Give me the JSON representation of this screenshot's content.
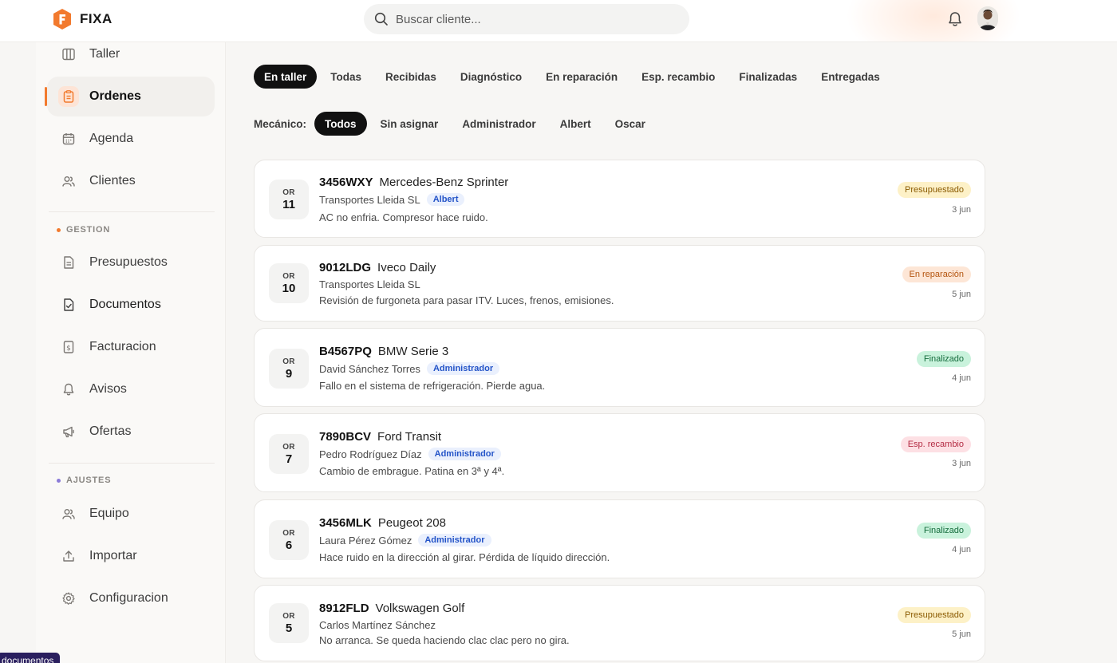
{
  "app": {
    "name": "FIXA",
    "brand_color": "#f27a2e"
  },
  "search": {
    "placeholder": "Buscar cliente..."
  },
  "sidebar": {
    "items": [
      {
        "label": "Taller",
        "icon": "columns-icon",
        "active": false
      },
      {
        "label": "Ordenes",
        "icon": "clipboard-icon",
        "active": true
      },
      {
        "label": "Agenda",
        "icon": "calendar-icon",
        "active": false
      },
      {
        "label": "Clientes",
        "icon": "users-icon",
        "active": false
      }
    ],
    "gestion": {
      "title": "GESTION",
      "items": [
        {
          "label": "Presupuestos",
          "icon": "file-text-icon"
        },
        {
          "label": "Documentos",
          "icon": "file-check-icon"
        },
        {
          "label": "Facturacion",
          "icon": "dollar-file-icon"
        },
        {
          "label": "Avisos",
          "icon": "bell-icon"
        },
        {
          "label": "Ofertas",
          "icon": "megaphone-icon"
        }
      ]
    },
    "ajustes": {
      "title": "AJUSTES",
      "items": [
        {
          "label": "Equipo",
          "icon": "users-icon"
        },
        {
          "label": "Importar",
          "icon": "upload-icon"
        },
        {
          "label": "Configuracion",
          "icon": "gear-icon"
        }
      ]
    }
  },
  "tooltip": {
    "text": "documentos"
  },
  "status_tabs": [
    "En taller",
    "Todas",
    "Recibidas",
    "Diagnóstico",
    "En reparación",
    "Esp. recambio",
    "Finalizadas",
    "Entregadas"
  ],
  "status_tab_active": "En taller",
  "mechanic_filter": {
    "label": "Mecánico:",
    "options": [
      "Todos",
      "Sin asignar",
      "Administrador",
      "Albert",
      "Oscar"
    ],
    "active": "Todos"
  },
  "orders": [
    {
      "or_label": "OR",
      "number": "11",
      "plate": "3456WXY",
      "model": "Mercedes-Benz Sprinter",
      "client": "Transportes Lleida SL",
      "mechanic": "Albert",
      "description": "AC no enfria. Compresor hace ruido.",
      "status": "Presupuestado",
      "date": "3 jun"
    },
    {
      "or_label": "OR",
      "number": "10",
      "plate": "9012LDG",
      "model": "Iveco Daily",
      "client": "Transportes Lleida SL",
      "mechanic": "",
      "description": "Revisión de furgoneta para pasar ITV. Luces, frenos, emisiones.",
      "status": "En reparación",
      "date": "5 jun"
    },
    {
      "or_label": "OR",
      "number": "9",
      "plate": "B4567PQ",
      "model": "BMW Serie 3",
      "client": "David Sánchez Torres",
      "mechanic": "Administrador",
      "description": "Fallo en el sistema de refrigeración. Pierde agua.",
      "status": "Finalizado",
      "date": "4 jun"
    },
    {
      "or_label": "OR",
      "number": "7",
      "plate": "7890BCV",
      "model": "Ford Transit",
      "client": "Pedro Rodríguez Díaz",
      "mechanic": "Administrador",
      "description": "Cambio de embrague. Patina en 3ª y 4ª.",
      "status": "Esp. recambio",
      "date": "3 jun"
    },
    {
      "or_label": "OR",
      "number": "6",
      "plate": "3456MLK",
      "model": "Peugeot 208",
      "client": "Laura Pérez Gómez",
      "mechanic": "Administrador",
      "description": "Hace ruido en la dirección al girar. Pérdida de líquido dirección.",
      "status": "Finalizado",
      "date": "4 jun"
    },
    {
      "or_label": "OR",
      "number": "5",
      "plate": "8912FLD",
      "model": "Volkswagen Golf",
      "client": "Carlos Martínez Sánchez",
      "mechanic": "",
      "description": "No arranca. Se queda haciendo clac clac pero no gira.",
      "status": "Presupuestado",
      "date": "5 jun"
    }
  ],
  "status_colors": {
    "Presupuestado": {
      "bg": "#fdf1c7",
      "fg": "#8a5a00"
    },
    "En reparación": {
      "bg": "#fde6d6",
      "fg": "#b4540f"
    },
    "Finalizado": {
      "bg": "#c9f2dc",
      "fg": "#146c3c"
    },
    "Esp. recambio": {
      "bg": "#fde0e4",
      "fg": "#b42c44"
    }
  }
}
